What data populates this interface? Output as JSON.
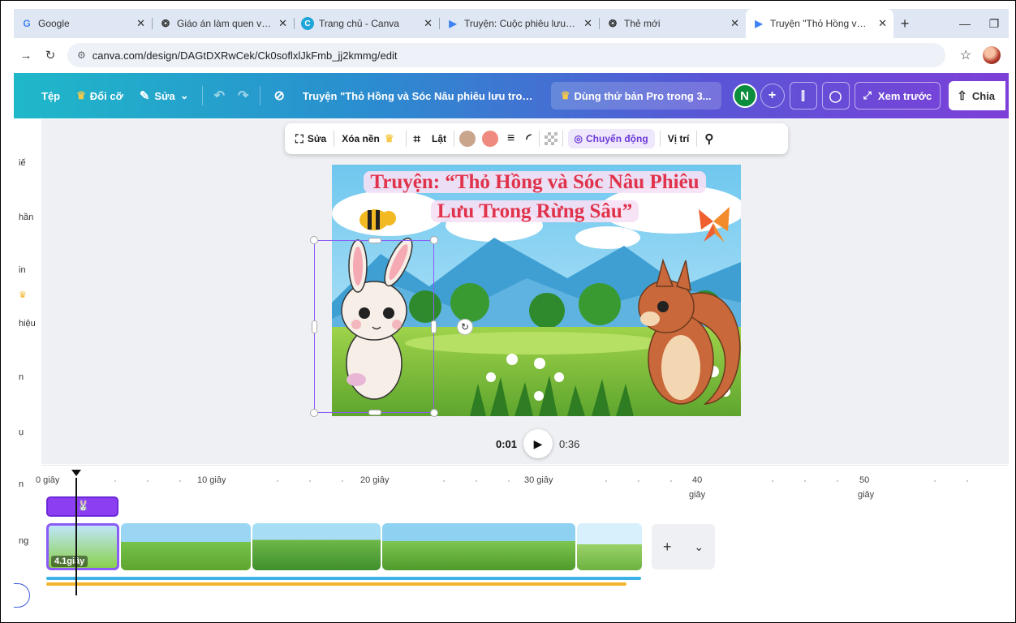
{
  "browser": {
    "tabs": [
      {
        "label": "Google",
        "icon": "google-icon",
        "active": false
      },
      {
        "label": "Giáo án làm quen văn học",
        "icon": "openai-icon",
        "active": false
      },
      {
        "label": "Trang chủ - Canva",
        "icon": "canva-icon",
        "active": false
      },
      {
        "label": "Truyện: Cuộc phiêu lưu - V",
        "icon": "canva-video-icon",
        "active": false
      },
      {
        "label": "Thẻ mới",
        "icon": "openai-icon",
        "active": false
      },
      {
        "label": "Truyện \"Thỏ Hồng và Sóc",
        "icon": "canva-video-icon",
        "active": true
      }
    ],
    "close_glyph": "✕",
    "new_tab_glyph": "+",
    "window_controls": {
      "minimize": "—",
      "restore": "❐"
    },
    "url": "canva.com/design/DAGtDXRwCek/Ck0soflxlJkFmb_jj2kmmg/edit"
  },
  "canva_header": {
    "file_label": "Tệp",
    "resize_label": "Đổi cỡ",
    "edit_label": "Sửa",
    "title": "Truyện \"Thỏ Hồng và Sóc Nâu phiêu lưu trong r...",
    "pro_label": "Dùng thử bản Pro trong 3...",
    "avatar_initial": "N",
    "preview_label": "Xem trước",
    "share_label": "Chia"
  },
  "sidebar_fragments": [
    "iế",
    "hần",
    "in",
    "♛",
    "hiệu",
    "n",
    "ụ",
    "n",
    "ng"
  ],
  "element_toolbar": {
    "edit_label": "Sửa",
    "remove_bg_label": "Xóa nền",
    "flip_label": "Lật",
    "motion_label": "Chuyển động",
    "position_label": "Vị trí",
    "swatch_colors": [
      "#c9a58c",
      "#ef8a7e"
    ]
  },
  "scene": {
    "title_line1": "Truyện: “Thỏ Hồng và Sóc Nâu Phiêu",
    "title_line2": "Lưu Trong Rừng Sâu”"
  },
  "playback": {
    "current": "0:01",
    "total": "0:36"
  },
  "timeline": {
    "ticks": [
      {
        "label": "0 giây",
        "sub": ""
      },
      {
        "label": "10 giây",
        "sub": ""
      },
      {
        "label": "20 giây",
        "sub": ""
      },
      {
        "label": "30 giây",
        "sub": ""
      },
      {
        "label": "40",
        "sub": "giây"
      },
      {
        "label": "50",
        "sub": "giây"
      }
    ],
    "selected_clip_duration": "4.1giây",
    "add_page_glyph": "+",
    "expand_glyph": "⌄"
  },
  "colors": {
    "accent": "#8b5cf6",
    "header_start": "#1fb8c9",
    "header_end": "#7d3fd8",
    "title_red": "#e0324a"
  }
}
